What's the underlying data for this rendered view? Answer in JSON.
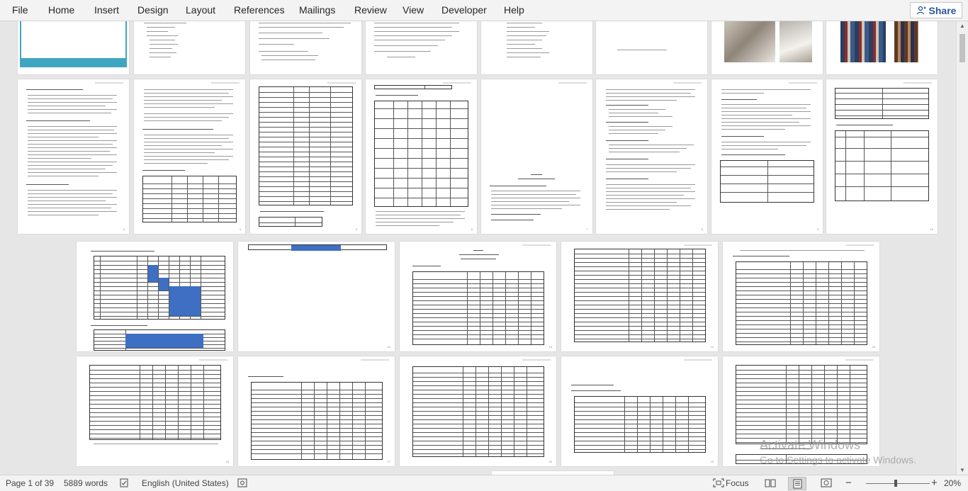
{
  "ribbon": {
    "tabs": [
      "File",
      "Home",
      "Insert",
      "Design",
      "Layout",
      "References",
      "Mailings",
      "Review",
      "View",
      "Developer",
      "Help"
    ],
    "share_label": "Share",
    "accent": "#2b579a"
  },
  "watermark": {
    "line1": "Activate Windows",
    "line2": "Go to Settings to activate Windows."
  },
  "status": {
    "page": "Page 1 of 39",
    "words": "5889 words",
    "language": "English (United States)",
    "focus": "Focus",
    "zoom": "20%",
    "zoom_minus": "−",
    "zoom_plus": "+"
  },
  "icons": {
    "share": "share-person-icon",
    "proofing": "proofing-check-icon",
    "accessibility": "accessibility-icon",
    "focus": "focus-icon",
    "read_mode": "read-mode-icon",
    "print_layout": "print-layout-icon",
    "web_layout": "web-layout-icon"
  }
}
